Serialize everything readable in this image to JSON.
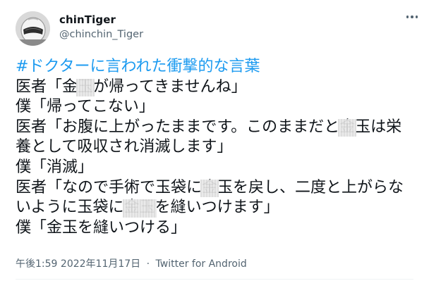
{
  "user": {
    "display_name": "chinTiger",
    "handle": "@chinchin_Tiger",
    "avatar_icon": "helmet-avatar"
  },
  "tweet": {
    "hashtag": "#ドクターに言われた衝撃的な言葉",
    "lines": [
      {
        "a": "医者「金",
        "r": "玉",
        "b": "が帰ってきませんね」"
      },
      {
        "a": "僕「帰ってこない」"
      },
      {
        "a": "医者「お腹に上がったままです。このままだと",
        "r": "金",
        "b": "玉は栄"
      },
      {
        "a": "養として吸収され消滅します」"
      },
      {
        "a": "僕「消滅」"
      },
      {
        "a": "医者「なので手術で玉袋に",
        "r": "金",
        "b": "玉を戻し、二度と上がらな"
      },
      {
        "a": "いように玉袋に",
        "r": "金玉",
        "b": "を縫いつけます」"
      },
      {
        "a": "僕「金玉を縫いつける」"
      }
    ]
  },
  "meta": {
    "time": "午後1:59",
    "separator": "·",
    "date": "2022年11月17日",
    "source": "Twitter for Android"
  },
  "colors": {
    "hashtag": "#1d9bf0",
    "secondary_text": "#536471",
    "primary_text": "#0f1419"
  },
  "icons": {
    "more": "more-horizontal-icon"
  }
}
